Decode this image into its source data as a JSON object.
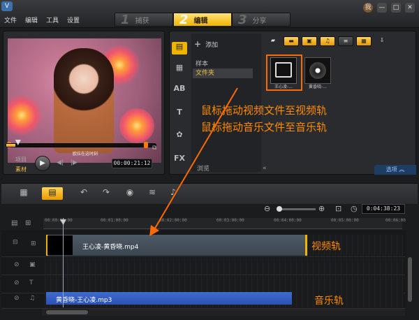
{
  "app": {
    "logo_label": "V"
  },
  "menu": [
    "文件",
    "编辑",
    "工具",
    "设置"
  ],
  "steps": [
    {
      "num": "1",
      "label": "捕获"
    },
    {
      "num": "2",
      "label": "编辑"
    },
    {
      "num": "3",
      "label": "分享"
    }
  ],
  "window_buttons": {
    "user": "我",
    "minimize": "—",
    "maximize": "□",
    "close": "✕"
  },
  "preview": {
    "caption": "欧拉在这时刻",
    "mode_project": "项目",
    "mode_clip": "素材",
    "timecode": "00:00:21:12"
  },
  "library": {
    "add_label": "添加",
    "tree": [
      "样本",
      "文件夹"
    ],
    "browse_label": "浏览",
    "options_label": "选项",
    "thumbs": [
      {
        "name": "王心凌-..."
      },
      {
        "name": "黄昏晓-..."
      }
    ]
  },
  "instructions": [
    "鼠标拖动视频文件至视频轨",
    "鼠标拖动音乐文件至音乐轨"
  ],
  "timeline": {
    "timecode": "0:04:38:23",
    "ruler": [
      "00:00:00:00",
      "00:01:00:00",
      "00:02:00:00",
      "00:03:00:00",
      "00:04:00:00",
      "00:05:00:00",
      "00:06:00"
    ],
    "video_clip": "王心凌-黄昏晓.mp4",
    "audio_clip": "黄昏晓-王心凌.mp3",
    "video_track_label": "视频轨",
    "audio_track_label": "音乐轨"
  },
  "colors": {
    "accent": "#f0b400",
    "annotation": "#ff8a00",
    "audio_clip": "#2b50b0"
  }
}
